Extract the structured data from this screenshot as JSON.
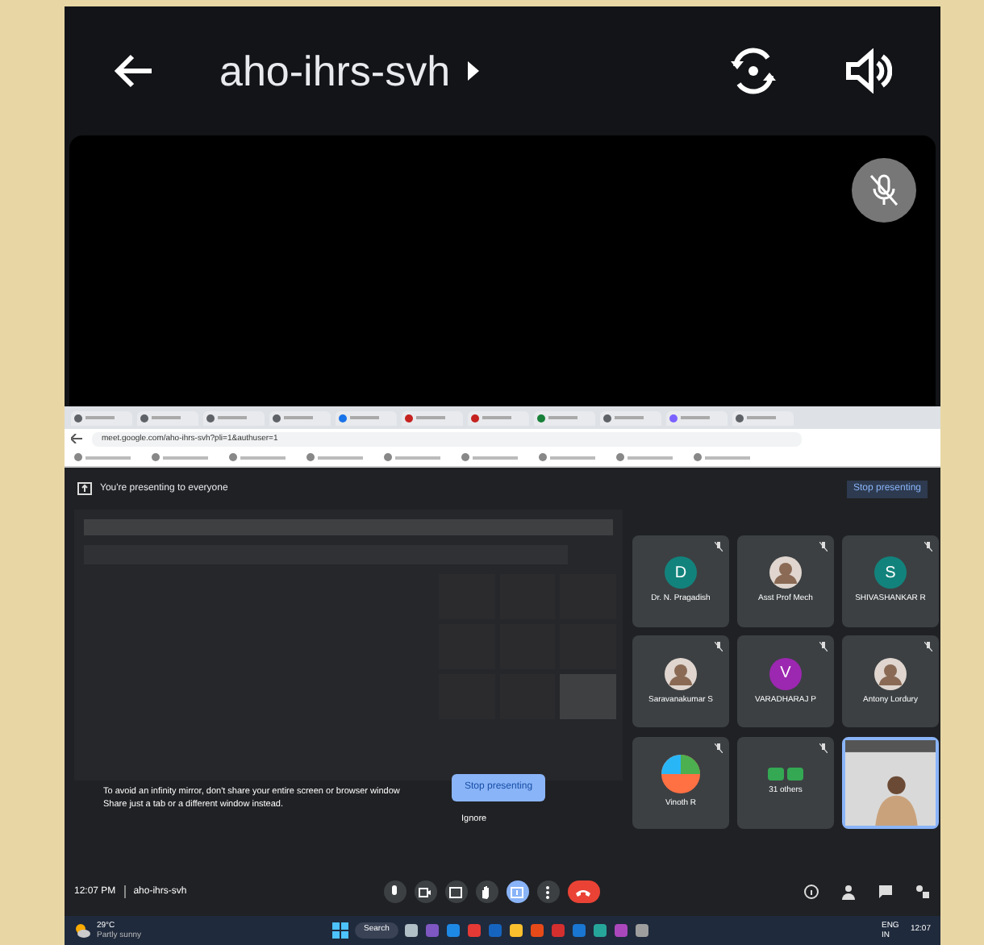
{
  "header": {
    "title": "aho-ihrs-svh"
  },
  "shared_screen": {
    "url": "meet.google.com/aho-ihrs-svh?pli=1&authuser=1",
    "tabs": [
      {
        "color": "#5f6368"
      },
      {
        "color": "#5f6368"
      },
      {
        "color": "#5f6368"
      },
      {
        "color": "#5f6368"
      },
      {
        "color": "#1a73e8"
      },
      {
        "color": "#c5221f"
      },
      {
        "color": "#c5221f"
      },
      {
        "color": "#188038"
      },
      {
        "color": "#5f6368"
      },
      {
        "color": "#7b61ff"
      },
      {
        "color": "#5f6368"
      }
    ],
    "presenting_banner": "You're presenting to everyone",
    "banner_stop": "Stop presenting",
    "participants": [
      {
        "kind": "initial",
        "initial": "D",
        "color": "#12837c",
        "name": "Dr. N. Pragadish"
      },
      {
        "name": "Asst Prof Mech"
      },
      {
        "kind": "initial",
        "initial": "S",
        "color": "#12837c",
        "name": "SHIVASHANKAR R"
      },
      {
        "name": "Saravanakumar S"
      },
      {
        "kind": "initial",
        "initial": "V",
        "color": "#9c27b0",
        "name": "VARADHARAJ P"
      },
      {
        "name": "Antony Lordury"
      },
      {
        "kind": "logo",
        "name": "Vinoth R"
      },
      {
        "kind": "others",
        "name": "31 others"
      },
      {
        "kind": "self"
      }
    ],
    "warning_lines": [
      "To avoid an infinity mirror, don't share your entire screen or browser window",
      "Share just a tab or a different window instead."
    ],
    "stop_button": "Stop presenting",
    "ignore": "Ignore",
    "time": "12:07 PM",
    "meeting_code": "aho-ihrs-svh",
    "controls": [
      {
        "kind": "mic",
        "selected": false
      },
      {
        "kind": "camera",
        "selected": false
      },
      {
        "kind": "captions",
        "selected": false
      },
      {
        "kind": "hand",
        "selected": false
      },
      {
        "kind": "present",
        "selected": true
      },
      {
        "kind": "more",
        "selected": false
      },
      {
        "kind": "end",
        "selected": false
      }
    ],
    "taskbar": {
      "temperature": "29°C",
      "weather": "Partly sunny",
      "search": "Search",
      "lang": "ENG IN",
      "clock": "12:07"
    }
  }
}
